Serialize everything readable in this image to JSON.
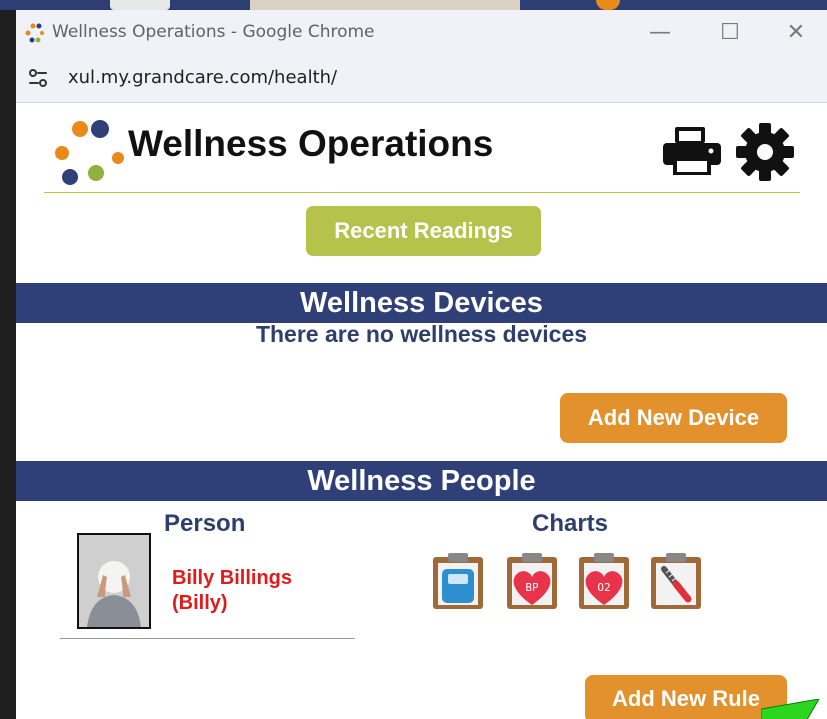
{
  "window": {
    "title": "Wellness Operations - Google Chrome",
    "minimize_glyph": "—",
    "maximize_glyph": "☐",
    "close_glyph": "✕"
  },
  "address_bar": {
    "url": "xul.my.grandcare.com/health/",
    "site_icon": "tune-icon"
  },
  "header": {
    "title": "Wellness Operations",
    "icons": [
      "print-icon",
      "gear-icon"
    ]
  },
  "recent_readings_label": "Recent Readings",
  "devices": {
    "heading": "Wellness Devices",
    "empty_message": "There are no wellness devices",
    "add_label": "Add New Device"
  },
  "people": {
    "heading": "Wellness People",
    "col_person": "Person",
    "col_charts": "Charts",
    "rows": [
      {
        "name_line1": "Billy Billings",
        "name_line2": "(Billy)",
        "charts": [
          {
            "icon": "weight-scale-chart-icon"
          },
          {
            "icon": "blood-pressure-chart-icon",
            "text": "BP"
          },
          {
            "icon": "oxygen-chart-icon",
            "text": "O2"
          },
          {
            "icon": "thermometer-chart-icon"
          }
        ]
      }
    ],
    "add_rule_label": "Add New Rule"
  },
  "colors": {
    "band": "#2f3f78",
    "green_button": "#b5c24c",
    "orange_button": "#e2912d",
    "person_name": "#e01b1b",
    "heading_text": "#2f3f6b"
  }
}
